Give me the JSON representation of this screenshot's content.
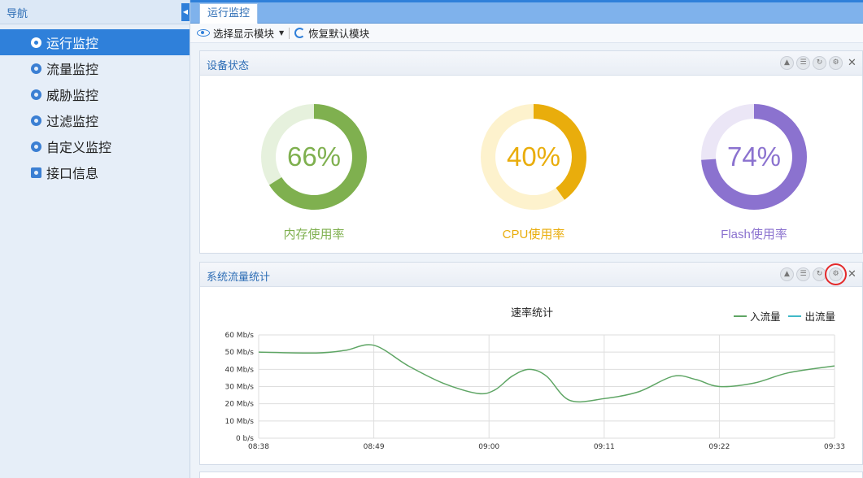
{
  "sidebar": {
    "title": "导航",
    "items": [
      {
        "label": "运行监控",
        "active": true
      },
      {
        "label": "流量监控"
      },
      {
        "label": "威胁监控"
      },
      {
        "label": "过滤监控"
      },
      {
        "label": "自定义监控"
      },
      {
        "label": "接口信息"
      }
    ]
  },
  "tab": {
    "label": "运行监控"
  },
  "toolbar": {
    "select_label": "选择显示模块",
    "reset_label": "恢复默认模块"
  },
  "device_panel": {
    "title": "设备状态",
    "gauges": [
      {
        "value": 66,
        "text": "66%",
        "label": "内存使用率",
        "color": "#7fb04f",
        "track": "#e6f1dd"
      },
      {
        "value": 40,
        "text": "40%",
        "label": "CPU使用率",
        "color": "#e9ad0c",
        "track": "#fdf2cd"
      },
      {
        "value": 74,
        "text": "74%",
        "label": "Flash使用率",
        "color": "#8b72cf",
        "track": "#ebe6f6"
      }
    ]
  },
  "traffic_panel": {
    "title": "系统流量统计"
  },
  "chart_data": {
    "type": "line",
    "title": "速率统计",
    "x_ticks": [
      "08:38",
      "08:49",
      "09:00",
      "09:11",
      "09:22",
      "09:33"
    ],
    "y_ticks": [
      "0 b/s",
      "10 Mb/s",
      "20 Mb/s",
      "30 Mb/s",
      "40 Mb/s",
      "50 Mb/s",
      "60 Mb/s"
    ],
    "ylim": [
      0,
      60
    ],
    "grid": true,
    "legend_position": "top-right",
    "series": [
      {
        "name": "入流量",
        "color": "#5ea564",
        "points": [
          {
            "x": 0.0,
            "y": 50
          },
          {
            "x": 0.5,
            "y": 49.5
          },
          {
            "x": 0.75,
            "y": 51
          },
          {
            "x": 1.0,
            "y": 54
          },
          {
            "x": 1.3,
            "y": 42
          },
          {
            "x": 1.6,
            "y": 32
          },
          {
            "x": 1.9,
            "y": 26
          },
          {
            "x": 2.05,
            "y": 28
          },
          {
            "x": 2.2,
            "y": 36
          },
          {
            "x": 2.35,
            "y": 40
          },
          {
            "x": 2.5,
            "y": 36
          },
          {
            "x": 2.7,
            "y": 22
          },
          {
            "x": 3.0,
            "y": 23
          },
          {
            "x": 3.3,
            "y": 27
          },
          {
            "x": 3.6,
            "y": 36
          },
          {
            "x": 3.8,
            "y": 34
          },
          {
            "x": 4.0,
            "y": 30
          },
          {
            "x": 4.3,
            "y": 32
          },
          {
            "x": 4.6,
            "y": 38
          },
          {
            "x": 5.0,
            "y": 42
          }
        ]
      },
      {
        "name": "出流量",
        "color": "#41b9c8",
        "points": []
      }
    ]
  }
}
